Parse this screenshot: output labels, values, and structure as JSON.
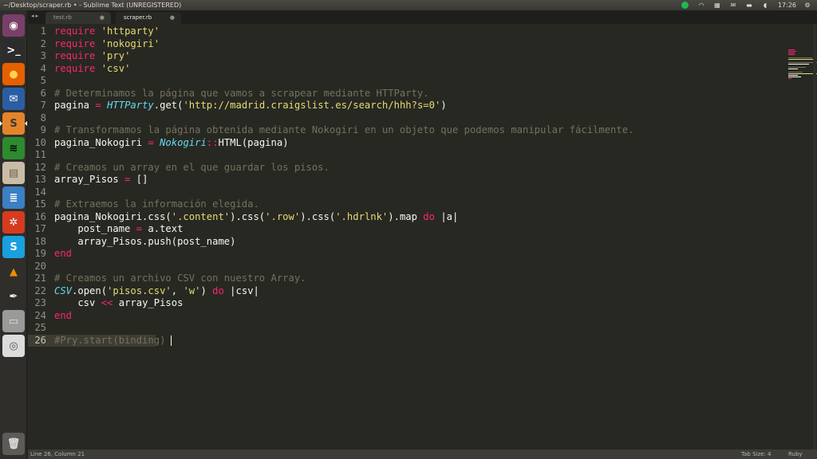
{
  "window": {
    "title": "~/Desktop/scraper.rb • - Sublime Text (UNREGISTERED)",
    "clock": "17:26"
  },
  "launcher": {
    "items": [
      {
        "name": "ubuntu-dash-icon",
        "glyph": "◉",
        "bg": "#7a3f69",
        "fg": "#ffffff"
      },
      {
        "name": "terminal-icon",
        "glyph": ">_",
        "bg": "#2c2c2c",
        "fg": "#ffffff"
      },
      {
        "name": "firefox-icon",
        "glyph": "●",
        "bg": "#e66000",
        "fg": "#ffd34e"
      },
      {
        "name": "thunderbird-icon",
        "glyph": "✉",
        "bg": "#2a5ea3",
        "fg": "#ffffff"
      },
      {
        "name": "sublime-text-icon",
        "glyph": "S",
        "bg": "#e4842a",
        "fg": "#3a3a3a"
      },
      {
        "name": "spotify-icon",
        "glyph": "≋",
        "bg": "#2d8a2f",
        "fg": "#000000"
      },
      {
        "name": "files-icon",
        "glyph": "▤",
        "bg": "#c9bda6",
        "fg": "#6a5f4c"
      },
      {
        "name": "writer-icon",
        "glyph": "≣",
        "bg": "#3b7fc4",
        "fg": "#ffffff"
      },
      {
        "name": "system-settings-icon",
        "glyph": "✲",
        "bg": "#d53c1f",
        "fg": "#ffffff"
      },
      {
        "name": "skype-icon",
        "glyph": "S",
        "bg": "#1aa0de",
        "fg": "#ffffff"
      },
      {
        "name": "vlc-icon",
        "glyph": "▲",
        "bg": "#2f2e2b",
        "fg": "#f38b00"
      },
      {
        "name": "inkscape-icon",
        "glyph": "✒",
        "bg": "#2f2e2b",
        "fg": "#ffffff"
      },
      {
        "name": "drive-icon",
        "glyph": "▭",
        "bg": "#9a9a98",
        "fg": "#e0e0e0"
      },
      {
        "name": "dvd-icon",
        "glyph": "◎",
        "bg": "#dcdcdc",
        "fg": "#555555"
      },
      {
        "name": "trash-icon",
        "glyph": "🗑",
        "bg": "#5c5b57",
        "fg": "#dddddd"
      }
    ]
  },
  "tabs": [
    {
      "label": "test.rb"
    },
    {
      "label": "scraper.rb"
    }
  ],
  "tab_close": "●",
  "editor": {
    "current_line": 26
  },
  "statusbar": {
    "position": "Line 26, Column 21",
    "tab_size": "Tab Size: 4",
    "syntax": "Ruby"
  }
}
